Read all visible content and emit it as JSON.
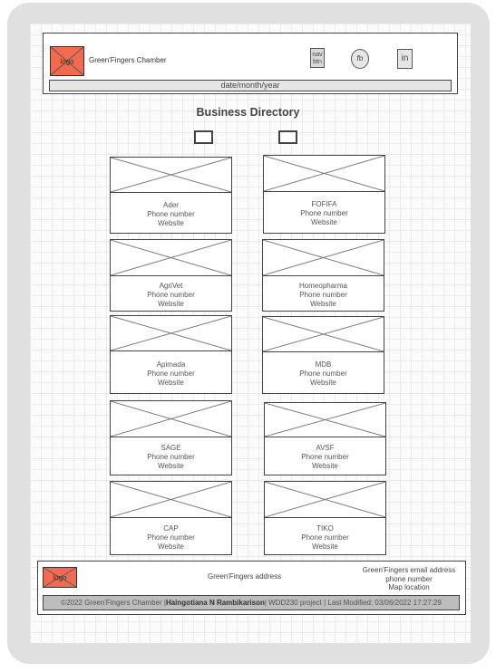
{
  "header": {
    "logo_label": "logo",
    "brand_name": "Green'Fingers Chamber",
    "nav_button": "nav btn",
    "fb_button": "fb",
    "in_button": "in",
    "date_text": "date/month/year"
  },
  "main": {
    "title": "Business Directory",
    "card_phone": "Phone number",
    "card_website": "Website",
    "cards": [
      {
        "name": "Ader"
      },
      {
        "name": "FOFIFA"
      },
      {
        "name": "AgriVet"
      },
      {
        "name": "Homeopharma"
      },
      {
        "name": "Apimada"
      },
      {
        "name": "MDB"
      },
      {
        "name": "SAGE"
      },
      {
        "name": "AVSF"
      },
      {
        "name": "CAP"
      },
      {
        "name": "TIKO"
      }
    ]
  },
  "footer": {
    "logo_label": "logo",
    "address": "Green'Fingers address",
    "email": "Green'Fingers email address",
    "phone": "phone number",
    "map": "Map location",
    "copyright_prefix": "©2022 Green'Fingers Chamber |",
    "author": "Haingotiana N Rambikarison",
    "copyright_suffix": "| WDD230 project | Last Modified: 03/06/2022 17:27:29"
  }
}
